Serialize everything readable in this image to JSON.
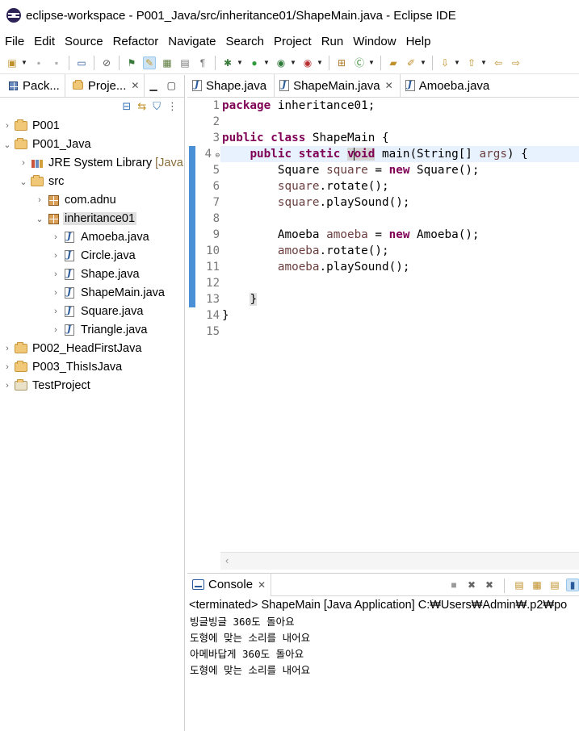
{
  "window": {
    "title": "eclipse-workspace - P001_Java/src/inheritance01/ShapeMain.java - Eclipse IDE"
  },
  "menu": [
    "File",
    "Edit",
    "Source",
    "Refactor",
    "Navigate",
    "Search",
    "Project",
    "Run",
    "Window",
    "Help"
  ],
  "left_panel": {
    "tabs": [
      {
        "label": "Pack...",
        "active": false
      },
      {
        "label": "Proje...",
        "active": true
      }
    ],
    "tree": [
      {
        "label": "P001",
        "depth": 0,
        "icon": "project-folder-icon",
        "expanded": false
      },
      {
        "label": "P001_Java",
        "depth": 0,
        "icon": "project-folder-icon",
        "expanded": true
      },
      {
        "label": "JRE System Library",
        "suffix": "[Java",
        "depth": 1,
        "icon": "library-icon",
        "expanded": false
      },
      {
        "label": "src",
        "depth": 1,
        "icon": "source-folder-icon",
        "expanded": true
      },
      {
        "label": "com.adnu",
        "depth": 2,
        "icon": "package-icon",
        "expanded": false
      },
      {
        "label": "inheritance01",
        "depth": 2,
        "icon": "package-icon",
        "expanded": true,
        "selected": true
      },
      {
        "label": "Amoeba.java",
        "depth": 3,
        "icon": "java-file-icon",
        "expanded": false
      },
      {
        "label": "Circle.java",
        "depth": 3,
        "icon": "java-file-icon",
        "expanded": false
      },
      {
        "label": "Shape.java",
        "depth": 3,
        "icon": "java-file-icon",
        "expanded": false
      },
      {
        "label": "ShapeMain.java",
        "depth": 3,
        "icon": "java-file-icon",
        "expanded": false
      },
      {
        "label": "Square.java",
        "depth": 3,
        "icon": "java-file-icon",
        "expanded": false
      },
      {
        "label": "Triangle.java",
        "depth": 3,
        "icon": "java-file-icon",
        "expanded": false
      },
      {
        "label": "P002_HeadFirstJava",
        "depth": 0,
        "icon": "project-folder-icon",
        "expanded": false
      },
      {
        "label": "P003_ThisIsJava",
        "depth": 0,
        "icon": "project-folder-icon",
        "expanded": false
      },
      {
        "label": "TestProject",
        "depth": 0,
        "icon": "project-plain-icon",
        "expanded": false
      }
    ]
  },
  "editor": {
    "tabs": [
      {
        "label": "Shape.java",
        "active": false
      },
      {
        "label": "ShapeMain.java",
        "active": true
      },
      {
        "label": "Amoeba.java",
        "active": false
      }
    ],
    "line_numbers": [
      "1",
      "2",
      "3",
      "4",
      "5",
      "6",
      "7",
      "8",
      "9",
      "10",
      "11",
      "12",
      "13",
      "14",
      "15"
    ],
    "code": {
      "l1_kw": "package",
      "l1_rest": " inheritance01;",
      "l3_kw1": "public",
      "l3_kw2": "class",
      "l3_rest": " ShapeMain {",
      "l4_kw1": "public",
      "l4_kw2": "static",
      "l4_kw3a": "v",
      "l4_kw3b": "oid",
      "l4_rest": " main(String[] ",
      "l4_param": "args",
      "l4_end": ") {",
      "l5_type": "Square ",
      "l5_var": "square",
      "l5_mid": " = ",
      "l5_kw": "new",
      "l5_rest": " Square();",
      "l6_var": "square",
      "l6_rest": ".rotate();",
      "l7_var": "square",
      "l7_rest": ".playSound();",
      "l9_type": "Amoeba ",
      "l9_var": "amoeba",
      "l9_mid": " = ",
      "l9_kw": "new",
      "l9_rest": " Amoeba();",
      "l10_var": "amoeba",
      "l10_rest": ".rotate();",
      "l11_var": "amoeba",
      "l11_rest": ".playSound();",
      "l13": "}",
      "l14": "}"
    }
  },
  "console": {
    "tab_label": "Console",
    "status": "<terminated> ShapeMain [Java Application] C:₩Users₩Admin₩.p2₩po",
    "output": [
      "빙글빙글 360도 돌아요",
      "도형에 맞는 소리를 내어요",
      "아메바답게 360도 돌아요",
      "도형에 맞는 소리를 내어요"
    ]
  },
  "colors": {
    "keyword": "#7f0055",
    "local_variable": "#6a3e3e",
    "line_number": "#787878",
    "current_line": "#e8f2fe",
    "change_ruler": "#4a90d6"
  }
}
